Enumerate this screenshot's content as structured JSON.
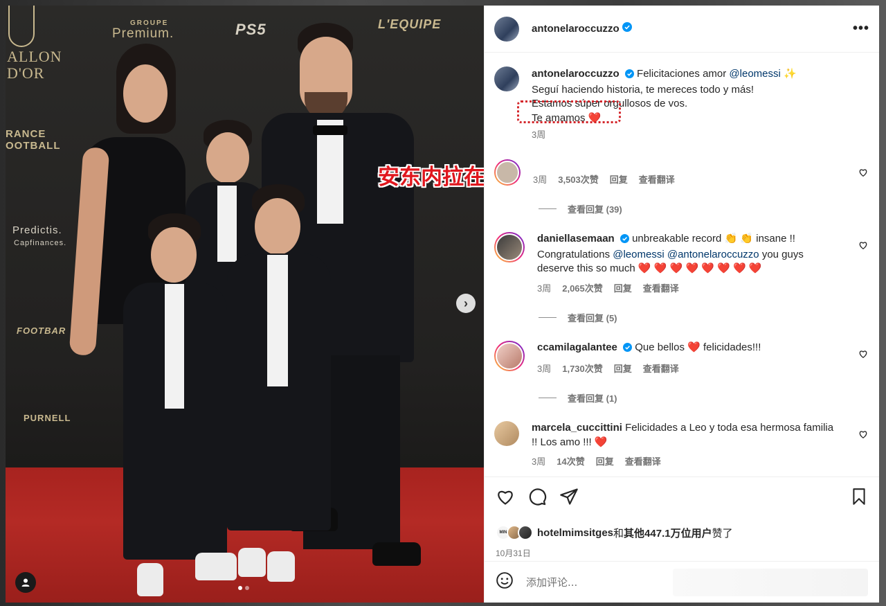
{
  "overlay": {
    "caption": "安东内拉在金球奖颁奖典礼后发INS晒全家福"
  },
  "media": {
    "wall_text": {
      "ballon_dor": "ALLON\nD'OR",
      "groupe": "GROUPE",
      "premium": "Premium.",
      "ps5": "PS5",
      "lequipe": "L'EQUIPE",
      "france_football": "RANCE\nOOTBALL",
      "predictis": "Predictis.",
      "capfinances": "Capfinances.",
      "footbar": "FOOTBAR",
      "purnell": "PURNELL"
    },
    "icons": {
      "next": "chevron-right-icon",
      "tag": "user-tag-icon"
    }
  },
  "post": {
    "author": "antonelaroccuzzo",
    "more_icon": "more-horizontal-icon",
    "caption": {
      "username": "antonelaroccuzzo",
      "line1_prefix": "Felicitaciones amor",
      "mention": "@leomessi",
      "sparkle": "✨",
      "line2": "Seguí haciendo historia, te mereces todo y más!",
      "line3": "Estamos súper orgullosos de vos.",
      "line4": "Te amamos",
      "heart": "❤️",
      "time": "3周"
    },
    "comments": [
      {
        "username": "",
        "text": "",
        "time": "3周",
        "likes": "3,503次赞",
        "reply": "回复",
        "translate": "查看翻译",
        "view_replies": "查看回复 (39)"
      },
      {
        "username": "daniellasemaan",
        "text_prefix": "unbreakable record",
        "emoji1": "👏",
        "emoji2": "👏",
        "text_suffix": "insane !!",
        "line2_prefix": "Congratulations",
        "mention1": "@leomessi",
        "mention2": "@antonelaroccuzzo",
        "line2_suffix": "you guys",
        "line3": "deserve this so much",
        "hearts": "❤️ ❤️ ❤️ ❤️ ❤️ ❤️ ❤️ ❤️",
        "time": "3周",
        "likes": "2,065次赞",
        "reply": "回复",
        "translate": "查看翻译",
        "view_replies": "查看回复 (5)"
      },
      {
        "username": "ccamilagalantee",
        "text_prefix": "Que bellos",
        "heart": "❤️",
        "text_suffix": "felicidades!!!",
        "time": "3周",
        "likes": "1,730次赞",
        "reply": "回复",
        "translate": "查看翻译",
        "view_replies": "查看回复 (1)"
      },
      {
        "username": "marcela_cuccittini",
        "text": "Felicidades a Leo y toda esa hermosa familia",
        "line2": "!! Los amo !!!",
        "heart": "❤️",
        "time": "3周",
        "likes": "14次赞",
        "reply": "回复",
        "translate": "查看翻译"
      }
    ],
    "actions": {
      "like_icon": "heart-icon",
      "comment_icon": "comment-icon",
      "share_icon": "send-icon",
      "save_icon": "bookmark-icon"
    },
    "likes_user": "hotelmimsitges",
    "likes_and": "和",
    "likes_rest": "其他447.1万位用户",
    "likes_suffix": "赞了",
    "date": "10月31日",
    "mini_avatar_label": "MIN",
    "add_comment_placeholder": "添加评论..."
  }
}
